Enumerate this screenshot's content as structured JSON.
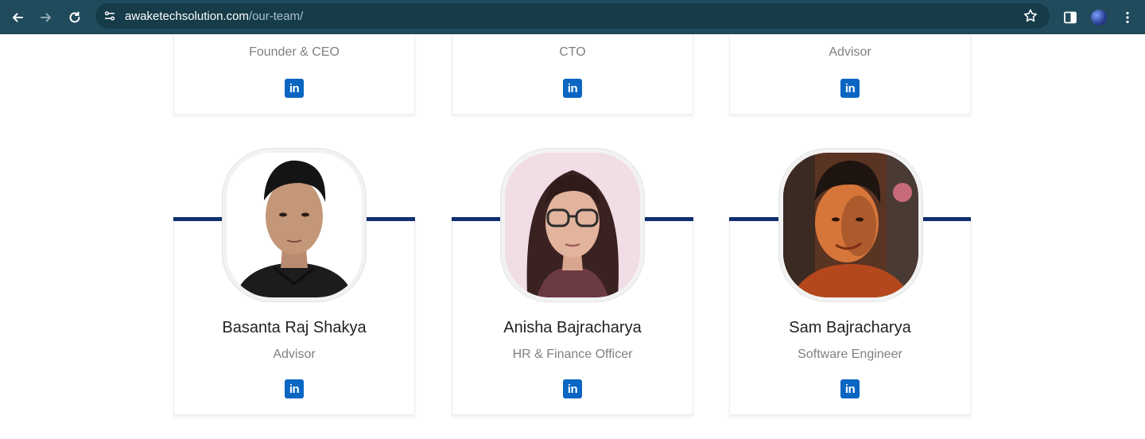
{
  "browser": {
    "url_domain": "awaketechsolution.com",
    "url_path": "/our-team/"
  },
  "colors": {
    "chrome_bg": "#1f4b5c",
    "accent_bar": "#0f2f6e",
    "linkedin": "#0a66c2"
  },
  "team_top": [
    {
      "role": "Founder & CEO",
      "icon": "linkedin-icon"
    },
    {
      "role": "CTO",
      "icon": "linkedin-icon"
    },
    {
      "role": "Advisor",
      "icon": "linkedin-icon"
    }
  ],
  "team_bottom": [
    {
      "name": "Basanta Raj Shakya",
      "role": "Advisor",
      "icon": "linkedin-icon"
    },
    {
      "name": "Anisha Bajracharya",
      "role": "HR & Finance Officer",
      "icon": "linkedin-icon"
    },
    {
      "name": "Sam Bajracharya",
      "role": "Software Engineer",
      "icon": "linkedin-icon"
    }
  ],
  "linkedin_glyph": "in"
}
